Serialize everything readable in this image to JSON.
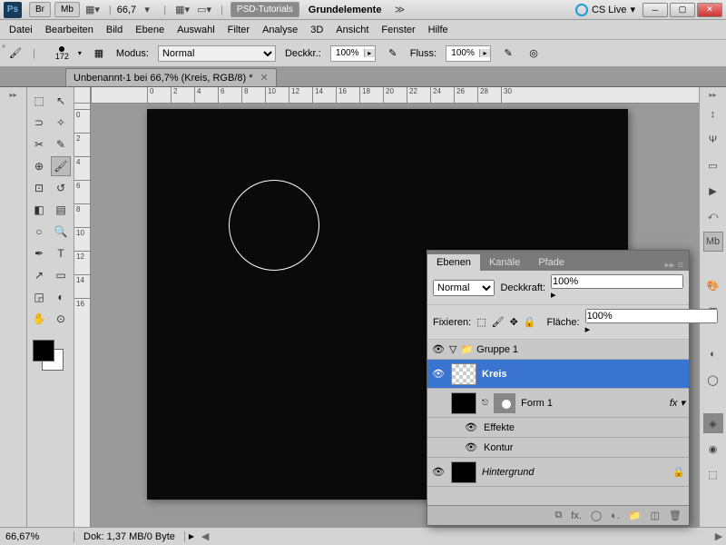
{
  "titlebar": {
    "zoom": "66,7",
    "btn_psdtut": "PSD-Tutorials",
    "btn_grund": "Grundelemente",
    "cslive": "CS Live"
  },
  "menu": [
    "Datei",
    "Bearbeiten",
    "Bild",
    "Ebene",
    "Auswahl",
    "Filter",
    "Analyse",
    "3D",
    "Ansicht",
    "Fenster",
    "Hilfe"
  ],
  "opt": {
    "brush_size": "172",
    "mode_label": "Modus:",
    "mode_value": "Normal",
    "opacity_label": "Deckkr.:",
    "opacity_value": "100%",
    "flow_label": "Fluss:",
    "flow_value": "100%"
  },
  "doc_tab": "Unbenannt-1 bei 66,7% (Kreis, RGB/8) *",
  "ruler_h": [
    "0",
    "2",
    "4",
    "6",
    "8",
    "10",
    "12",
    "14",
    "16",
    "18",
    "20",
    "22",
    "24",
    "26",
    "28",
    "30"
  ],
  "ruler_v": [
    "0",
    "2",
    "4",
    "6",
    "8",
    "10",
    "12",
    "14",
    "16"
  ],
  "status": {
    "zoom": "66,67%",
    "info": "Dok: 1,37 MB/0 Byte"
  },
  "layers": {
    "tabs": [
      "Ebenen",
      "Kanäle",
      "Pfade"
    ],
    "blend": "Normal",
    "opacity_label": "Deckkraft:",
    "opacity": "100%",
    "lock_label": "Fixieren:",
    "fill_label": "Fläche:",
    "fill": "100%",
    "group": "Gruppe 1",
    "l_kreis": "Kreis",
    "l_form": "Form 1",
    "l_effekte": "Effekte",
    "l_kontur": "Kontur",
    "l_bg": "Hintergrund"
  }
}
